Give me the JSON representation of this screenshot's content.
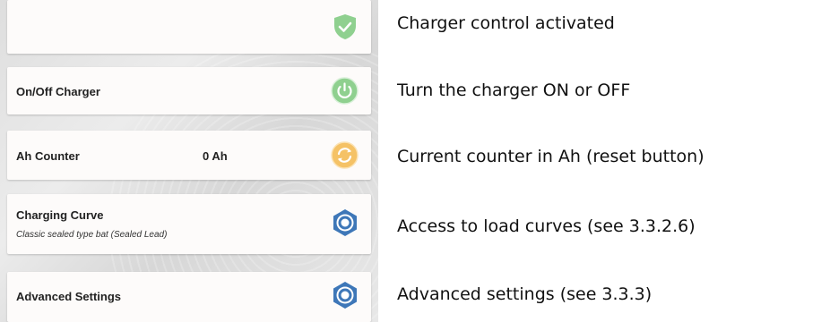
{
  "cards": {
    "charger_control": {
      "icon": "shield-check-icon"
    },
    "on_off": {
      "label": "On/Off Charger",
      "icon": "power-icon"
    },
    "ah_counter": {
      "label": "Ah Counter",
      "value": "0 Ah",
      "icon": "reset-icon"
    },
    "charging_curve": {
      "label": "Charging Curve",
      "subtitle": "Classic sealed type bat (Sealed Lead)",
      "icon": "gear-icon"
    },
    "advanced": {
      "label": "Advanced Settings",
      "icon": "gear-icon"
    }
  },
  "descriptions": {
    "charger_control": "Charger control activated",
    "on_off": "Turn the charger ON or OFF",
    "ah_counter": "Current counter in Ah (reset button)",
    "charging_curve": "Access to load curves (see 3.3.2.6)",
    "advanced": "Advanced settings (see 3.3.3)"
  },
  "colors": {
    "shield": "#8fd08f",
    "power": "#8fd08f",
    "reset": "#f5c266",
    "gear": "#3e77b8"
  }
}
